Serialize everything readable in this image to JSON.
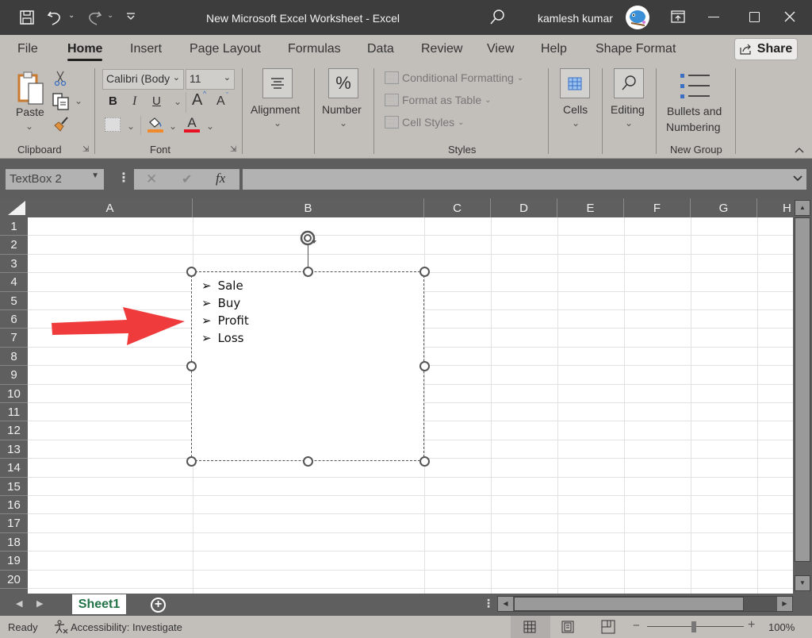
{
  "titlebar": {
    "document_title": "New Microsoft Excel Worksheet  -  Excel",
    "user_name": "kamlesh kumar",
    "icons": [
      "save-icon",
      "undo-icon",
      "redo-icon",
      "customize-qat-icon",
      "search-icon",
      "avatar",
      "ribbon-display-icon",
      "minimize-icon",
      "maximize-icon",
      "close-icon"
    ]
  },
  "tabs": [
    {
      "label": "File"
    },
    {
      "label": "Home",
      "active": true
    },
    {
      "label": "Insert"
    },
    {
      "label": "Page Layout"
    },
    {
      "label": "Formulas"
    },
    {
      "label": "Data"
    },
    {
      "label": "Review"
    },
    {
      "label": "View"
    },
    {
      "label": "Help"
    },
    {
      "label": "Shape Format"
    }
  ],
  "share_label": "Share",
  "ribbon": {
    "clipboard": {
      "label": "Clipboard",
      "paste": "Paste"
    },
    "font": {
      "label": "Font",
      "font_name": "Calibri (Body",
      "font_size": "11",
      "bold": "B",
      "italic": "I",
      "underline": "U",
      "grow": "A",
      "shrink": "A",
      "font_color_glyph": "A",
      "fill_color": "#f08a2c",
      "font_color": "#e81123"
    },
    "alignment": {
      "label": "Alignment"
    },
    "number": {
      "label": "Number",
      "glyph": "%"
    },
    "styles": {
      "label": "Styles",
      "items": [
        "Conditional Formatting",
        "Format as Table",
        "Cell Styles"
      ]
    },
    "cells": {
      "label": "Cells"
    },
    "editing": {
      "label": "Editing"
    },
    "new_group": {
      "label": "New Group",
      "button_line1": "Bullets and",
      "button_line2": "Numbering"
    }
  },
  "formula_bar": {
    "name_box": "TextBox 2",
    "cancel_glyph": "✕",
    "enter_glyph": "✔",
    "fx_glyph": "fx",
    "formula_value": ""
  },
  "columns": [
    "A",
    "B",
    "C",
    "D",
    "E",
    "F",
    "G",
    "H"
  ],
  "rows": [
    "1",
    "2",
    "3",
    "4",
    "5",
    "6",
    "7",
    "8",
    "9",
    "10",
    "11",
    "12",
    "13",
    "14",
    "15",
    "16",
    "17",
    "18",
    "19",
    "20"
  ],
  "textbox": {
    "bullet_glyph": "➢",
    "items": [
      "Sale",
      "Buy",
      "Profit",
      "Loss"
    ]
  },
  "annotation_arrow_color": "#ef3b3b",
  "sheets": [
    {
      "label": "Sheet1",
      "active": true
    }
  ],
  "status": {
    "mode": "Ready",
    "accessibility": "Accessibility: Investigate",
    "zoom": "100%",
    "zoom_minus": "−",
    "zoom_plus": "+"
  }
}
